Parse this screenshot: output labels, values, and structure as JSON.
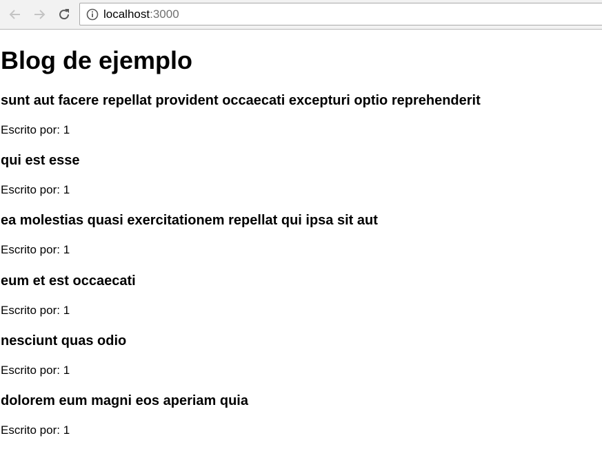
{
  "browser": {
    "url_host": "localhost",
    "url_port": ":3000",
    "icons": {
      "back": "arrow-left-icon",
      "forward": "arrow-right-icon",
      "reload": "reload-icon",
      "site_info": "info-icon"
    }
  },
  "page": {
    "title": "Blog de ejemplo",
    "posts": [
      {
        "title": "sunt aut facere repellat provident occaecati excepturi optio reprehenderit",
        "author": "Escrito por: 1"
      },
      {
        "title": "qui est esse",
        "author": "Escrito por: 1"
      },
      {
        "title": "ea molestias quasi exercitationem repellat qui ipsa sit aut",
        "author": "Escrito por: 1"
      },
      {
        "title": "eum et est occaecati",
        "author": "Escrito por: 1"
      },
      {
        "title": "nesciunt quas odio",
        "author": "Escrito por: 1"
      },
      {
        "title": "dolorem eum magni eos aperiam quia",
        "author": "Escrito por: 1"
      }
    ]
  }
}
